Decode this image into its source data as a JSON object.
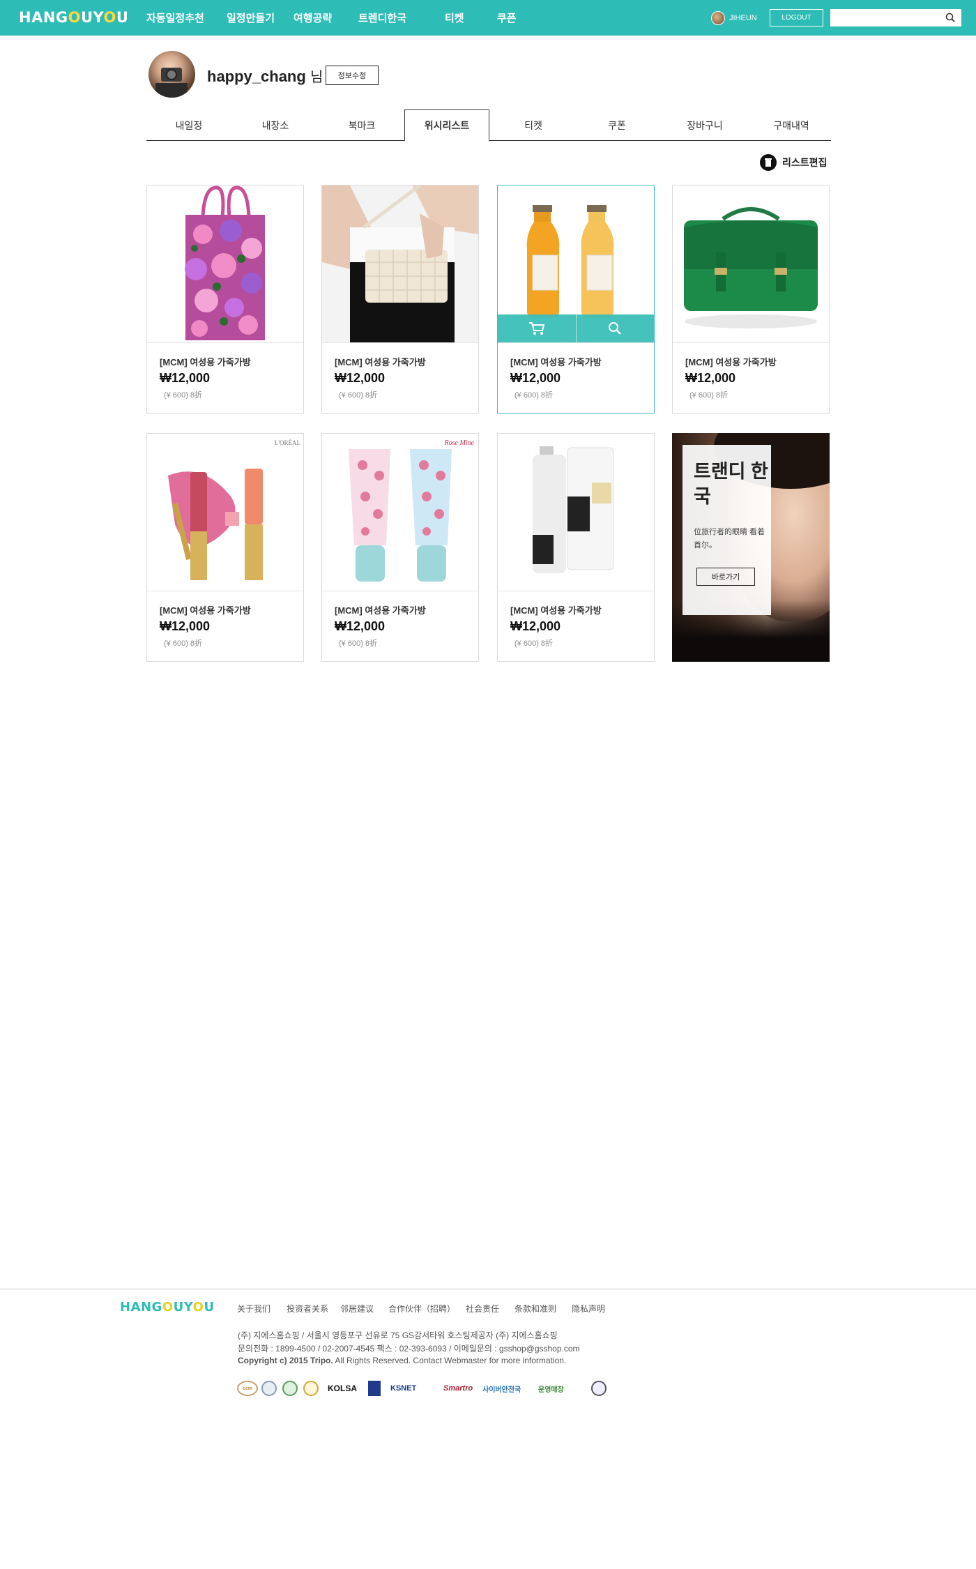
{
  "header": {
    "logo": {
      "pre": "HANG",
      "o1": "O",
      "mid": "UY",
      "o2": "O",
      "post": "U"
    },
    "nav": [
      "자동일정추천",
      "일정만들기",
      "여행공략",
      "트렌디한국",
      "티켓",
      "쿠폰"
    ],
    "user_name": "JIHEUN",
    "logout_label": "LOGOUT",
    "search_placeholder": ""
  },
  "profile": {
    "username": "happy_chang",
    "suffix": "님",
    "edit_label": "정보수정"
  },
  "tabs": {
    "items": [
      "내일정",
      "내장소",
      "북마크",
      "위시리스트",
      "티켓",
      "쿠폰",
      "장바구니",
      "구매내역"
    ],
    "active": "위시리스트"
  },
  "list_edit_label": "리스트편집",
  "products": [
    {
      "name": "[MCM] 여성용 가죽가방",
      "price": "₩12,000",
      "sub": "(¥ 600) 8折",
      "image": "floral-tote-bag"
    },
    {
      "name": "[MCM] 여성용 가죽가방",
      "price": "₩12,000",
      "sub": "(¥ 600) 8折",
      "image": "quilted-shoulder-bag"
    },
    {
      "name": "[MCM] 여성용 가죽가방",
      "price": "₩12,000",
      "sub": "(¥ 600) 8折",
      "image": "juice-bottles"
    },
    {
      "name": "[MCM] 여성용 가죽가방",
      "price": "₩12,000",
      "sub": "(¥ 600) 8折",
      "image": "green-satchel"
    },
    {
      "name": "[MCM] 여성용 가죽가방",
      "price": "₩12,000",
      "sub": "(¥ 600) 8折",
      "image": "lip-gloss",
      "brand_mark": "L'ORÉAL"
    },
    {
      "name": "[MCM] 여성용 가죽가방",
      "price": "₩12,000",
      "sub": "(¥ 600) 8折",
      "image": "floral-tubes",
      "brand_mark": "Rose Mine"
    },
    {
      "name": "[MCM] 여성용 가죽가방",
      "price": "₩12,000",
      "sub": "(¥ 600) 8折",
      "image": "skincare-bottles"
    }
  ],
  "banner": {
    "title": "트랜디 한국",
    "text": "位旅行者的眼睛 看着首尔。",
    "button": "바로가기"
  },
  "footer": {
    "logo": {
      "pre": "HANG",
      "o1": "O",
      "mid": "UY",
      "o2": "O",
      "post": "U"
    },
    "links": [
      "关于我们",
      "投资者关系",
      "邻居建议",
      "合作伙伴（招聘）",
      "社会责任",
      "条款和准则",
      "隐私声明"
    ],
    "info_line1": "(주) 지에스홈쇼핑  / 서울시 영등포구 선유로 75 GS강서타워 호스팅제공자 (주) 지에스홈쇼핑",
    "info_line2": "문의전화 : 1899-4500 / 02-2007-4545 팩스 : 02-393-6093 / 이메일문의 : gsshop@gsshop.com",
    "info_line3_bold": "Copyright c) 2015 Tripo.",
    "info_line3": " All Rights Reserved. Contact Webmaster for more information.",
    "badges": [
      "ccm",
      "KOLSA",
      "KSNET",
      "Smartro",
      "사이버안전국",
      "운영매장"
    ]
  }
}
